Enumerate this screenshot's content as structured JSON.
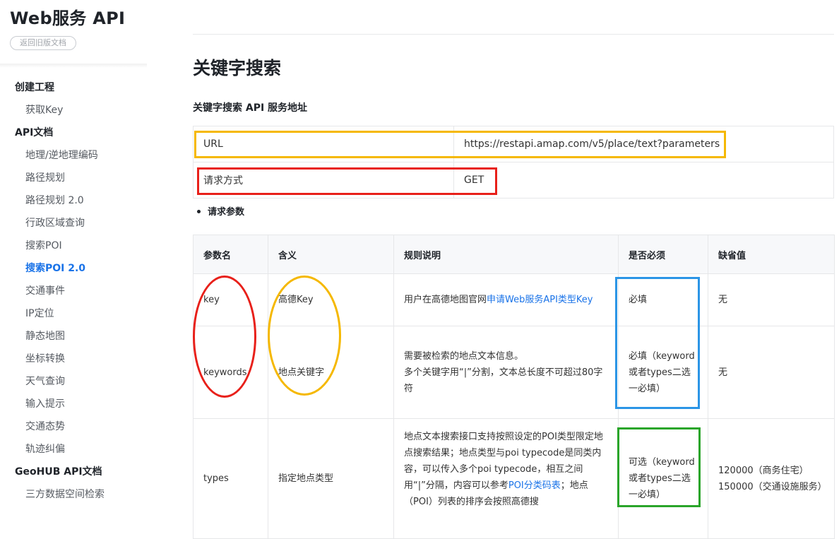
{
  "sidebar": {
    "brand": "Web服务 API",
    "old_docs_button": "返回旧版文档",
    "sections": [
      {
        "title": "创建工程",
        "items": [
          {
            "label": "获取Key"
          }
        ]
      },
      {
        "title": "API文档",
        "items": [
          {
            "label": "地理/逆地理编码"
          },
          {
            "label": "路径规划"
          },
          {
            "label": "路径规划 2.0"
          },
          {
            "label": "行政区域查询"
          },
          {
            "label": "搜索POI"
          },
          {
            "label": "搜索POI 2.0",
            "active": true
          },
          {
            "label": "交通事件"
          },
          {
            "label": "IP定位"
          },
          {
            "label": "静态地图"
          },
          {
            "label": "坐标转换"
          },
          {
            "label": "天气查询"
          },
          {
            "label": "输入提示"
          },
          {
            "label": "交通态势"
          },
          {
            "label": "轨迹纠偏"
          }
        ]
      },
      {
        "title": "GeoHUB API文档",
        "items": [
          {
            "label": "三方数据空间检索"
          }
        ]
      }
    ]
  },
  "main": {
    "title": "关键字搜索",
    "service_heading": "关键字搜索 API 服务地址",
    "info_table": [
      {
        "key": "URL",
        "value": "https://restapi.amap.com/v5/place/text?parameters"
      },
      {
        "key": "请求方式",
        "value": "GET"
      }
    ],
    "params_heading": "请求参数",
    "params_table": {
      "headers": [
        "参数名",
        "含义",
        "规则说明",
        "是否必须",
        "缺省值"
      ],
      "rows": [
        {
          "name": "key",
          "meaning": "高德Key",
          "rule_text": "用户在高德地图官网",
          "rule_link": "申请Web服务API类型Key",
          "required": "必填",
          "default": "无"
        },
        {
          "name": "keywords",
          "meaning": "地点关键字",
          "rule_lines": [
            "需要被检索的地点文本信息。",
            "多个关键字用“|”分割，文本总长度不可超过80字符"
          ],
          "required": "必填（keyword或者types二选一必填）",
          "default": "无"
        },
        {
          "name": "types",
          "meaning": "指定地点类型",
          "rule_text_1": "地点文本搜索接口支持按照设定的POI类型限定地点搜索结果；地点类型与poi typecode是同类内容，可以传入多个poi typecode，相互之间用“|”分隔，内容可以参考",
          "rule_link": "POI分类码表",
          "rule_text_2": "；地点（POI）列表的排序会按照高德搜",
          "required": "可选（keyword或者types二选一必填）",
          "default_lines": [
            "120000（商务住宅）",
            "150000（交通设施服务）"
          ]
        }
      ]
    }
  },
  "annotations": {
    "url_box_color": "#f5b800",
    "method_box_color": "#e8201a",
    "name_ellipse_color": "#e8201a",
    "meaning_ellipse_color": "#f5b800",
    "required_box_color": "#2b95e6",
    "optional_box_color": "#2aa52a"
  }
}
